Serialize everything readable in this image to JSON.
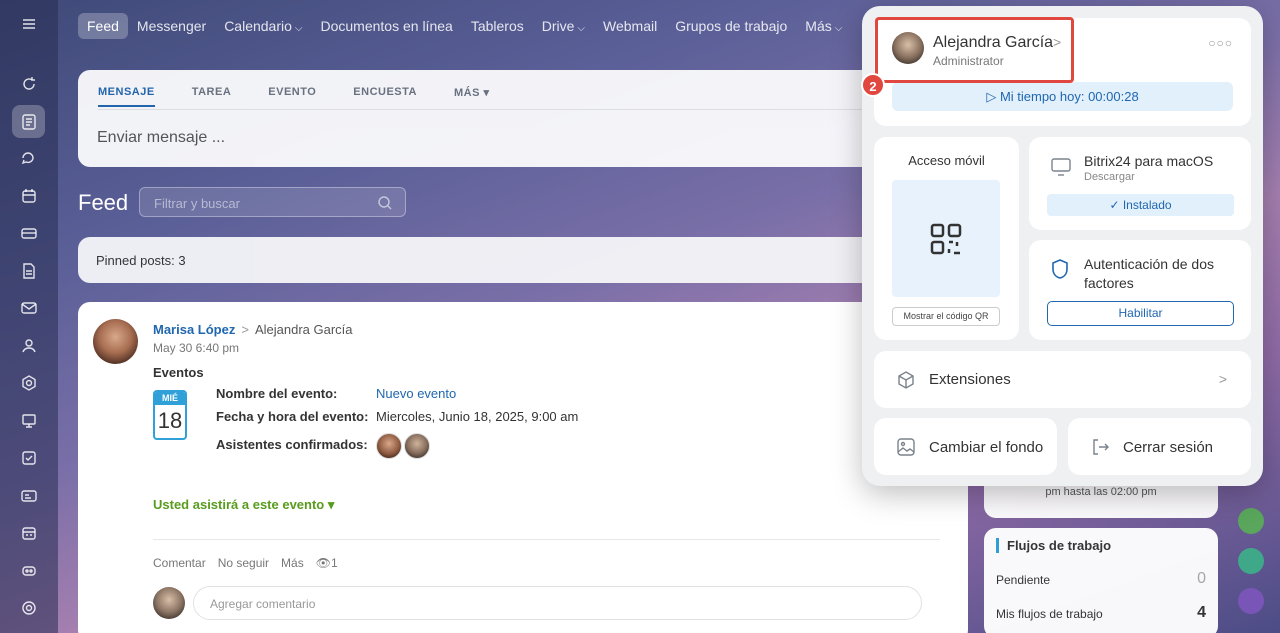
{
  "nav": {
    "items": [
      {
        "label": "Feed",
        "active": true,
        "dropdown": false
      },
      {
        "label": "Messenger",
        "dropdown": false
      },
      {
        "label": "Calendario",
        "dropdown": true
      },
      {
        "label": "Documentos en línea",
        "dropdown": false
      },
      {
        "label": "Tableros",
        "dropdown": false
      },
      {
        "label": "Drive",
        "dropdown": true
      },
      {
        "label": "Webmail",
        "dropdown": false
      },
      {
        "label": "Grupos de trabajo",
        "dropdown": false
      },
      {
        "label": "Más",
        "dropdown": true
      }
    ]
  },
  "composer": {
    "tabs": [
      "MENSAJE",
      "TAREA",
      "EVENTO",
      "ENCUESTA",
      "MÁS"
    ],
    "placeholder": "Enviar mensaje ..."
  },
  "feed": {
    "title": "Feed",
    "search_placeholder": "Filtrar y buscar",
    "pinned": "Pinned posts: 3"
  },
  "post": {
    "author": "Marisa López",
    "recipient": "Alejandra García",
    "date": "May 30 6:40 pm",
    "type": "Eventos",
    "calendar_month": "MIÉ",
    "calendar_day": "18",
    "event_name_label": "Nombre del evento:",
    "event_name": "Nuevo evento",
    "event_datetime_label": "Fecha y hora del evento:",
    "event_datetime": "Miercoles, Junio 18, 2025, 9:00 am",
    "attendees_label": "Asistentes confirmados:",
    "attend_status": "Usted asistirá a este evento",
    "actions": [
      "Comentar",
      "No seguir",
      "Más"
    ],
    "views": "1",
    "comment_placeholder": "Agregar comentario"
  },
  "right": {
    "partial_text": "pm hasta las 02:00 pm",
    "workflows_title": "Flujos de trabajo",
    "pending_label": "Pendiente",
    "pending_count": "0",
    "my_workflows_label": "Mis flujos de trabajo",
    "my_workflows_count": "4"
  },
  "profile": {
    "name": "Alejandra García",
    "role": "Administrator",
    "step_badge": "2",
    "time_today": "Mi tiempo hoy: 00:00:28",
    "mobile_title": "Acceso móvil",
    "qr_button": "Mostrar el código QR",
    "mac_title": "Bitrix24 para macOS",
    "mac_sub": "Descargar",
    "installed": "Instalado",
    "twofa_title": "Autenticación de dos factores",
    "enable": "Habilitar",
    "extensions": "Extensiones",
    "change_bg": "Cambiar el fondo",
    "logout": "Cerrar sesión"
  },
  "colors": {
    "accent": "#2067b0",
    "highlight": "#e0473e",
    "green": "#589c1d"
  }
}
